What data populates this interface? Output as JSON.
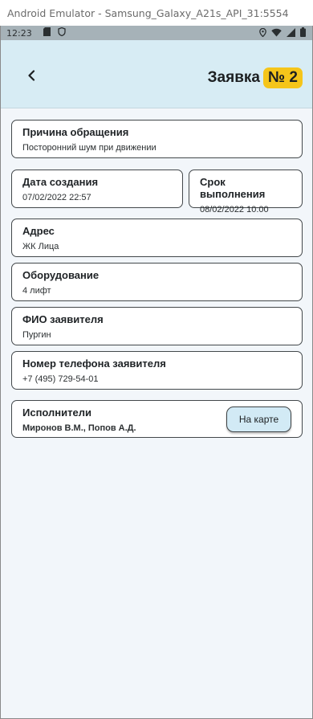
{
  "window": {
    "title": "Android Emulator - Samsung_Galaxy_A21s_API_31:5554"
  },
  "statusbar": {
    "time": "12:23"
  },
  "header": {
    "title": "Заявка",
    "number": "№ 2"
  },
  "fields": {
    "reason": {
      "label": "Причина обращения",
      "value": "Посторонний шум при движении"
    },
    "created": {
      "label": "Дата создания",
      "value": "07/02/2022 22:57"
    },
    "deadline": {
      "label": "Срок выполнения",
      "value": "08/02/2022 10:00"
    },
    "address": {
      "label": "Адрес",
      "value": "ЖК Лица"
    },
    "equipment": {
      "label": "Оборудование",
      "value": "4 лифт"
    },
    "applicant": {
      "label": "ФИО заявителя",
      "value": "Пургин"
    },
    "phone": {
      "label": "Номер телефона заявителя",
      "value": "+7 (495) 729-54-01"
    },
    "executors": {
      "label": "Исполнители",
      "value": "Миронов В.М., Попов А.Д.",
      "map_button": "На карте"
    }
  },
  "colors": {
    "appbar": "#d7ecf4",
    "badge": "#f5c51a",
    "background": "#f2f6fa"
  }
}
